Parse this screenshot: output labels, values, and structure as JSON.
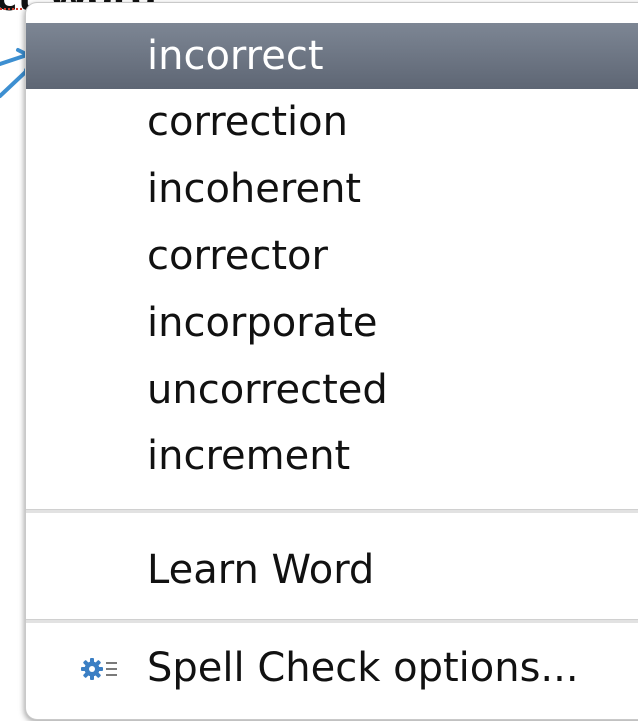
{
  "document": {
    "underlined_word_fragment": "ct Word:"
  },
  "menu": {
    "suggestions": [
      {
        "label": "incorrect",
        "selected": true
      },
      {
        "label": "correction",
        "selected": false
      },
      {
        "label": "incoherent",
        "selected": false
      },
      {
        "label": "corrector",
        "selected": false
      },
      {
        "label": "incorporate",
        "selected": false
      },
      {
        "label": "uncorrected",
        "selected": false
      },
      {
        "label": "increment",
        "selected": false
      }
    ],
    "learn_word_label": "Learn Word",
    "spell_check_options_label": "Spell Check options...",
    "spell_check_options_icon": "gear-list-icon"
  },
  "colors": {
    "selection_bg": "#6b7381",
    "pointer_arrow": "#3d8fd1",
    "misspelling_underline": "#d23c2c"
  }
}
